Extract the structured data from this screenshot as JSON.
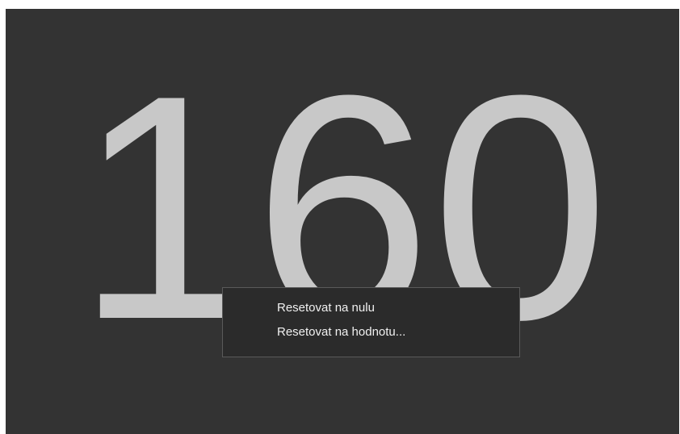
{
  "counter": {
    "value": "160"
  },
  "context_menu": {
    "items": [
      {
        "label": "Resetovat na nulu"
      },
      {
        "label": "Resetovat na hodnotu..."
      }
    ]
  },
  "colors": {
    "background": "#333333",
    "digits": "#c8c8c8",
    "menu_background": "#2b2b2b",
    "menu_border": "#5a5a5a",
    "menu_text": "#f0f0f0"
  }
}
